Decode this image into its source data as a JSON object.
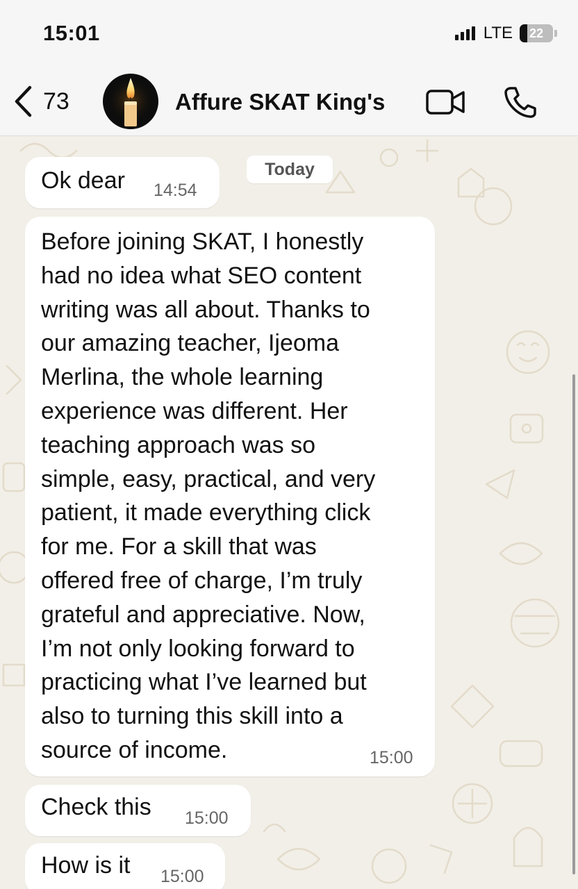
{
  "status_bar": {
    "time": "15:01",
    "network": "LTE",
    "battery": "22",
    "battery_level": 0.22
  },
  "header": {
    "back_count": "73",
    "title": "Affure SKAT King's",
    "avatar_icon": "candle-icon",
    "video_icon": "video-call-icon",
    "call_icon": "phone-icon"
  },
  "chat": {
    "date_chip": "Today",
    "messages": [
      {
        "text": "Ok dear",
        "time": "14:54"
      },
      {
        "text": "Before joining SKAT, I honestly\nhad no idea what SEO content\nwriting was all about. Thanks to\nour amazing teacher, Ijeoma\nMerlina, the whole learning\nexperience was different. Her\nteaching approach was so\nsimple, easy, practical, and very\npatient, it made everything click\nfor me. For a skill that was\noffered free of charge, I’m truly\ngrateful and appreciative. Now,\nI’m not only looking forward to\npracticing what I’ve learned but\nalso to turning this skill into a\nsource of income.",
        "time": "15:00"
      },
      {
        "text": "Check this",
        "time": "15:00"
      },
      {
        "text": "How is it",
        "time": "15:00"
      }
    ]
  },
  "colors": {
    "wallpaper": "#f2efe8",
    "bubble": "#ffffff",
    "header": "#f6f6f6"
  }
}
